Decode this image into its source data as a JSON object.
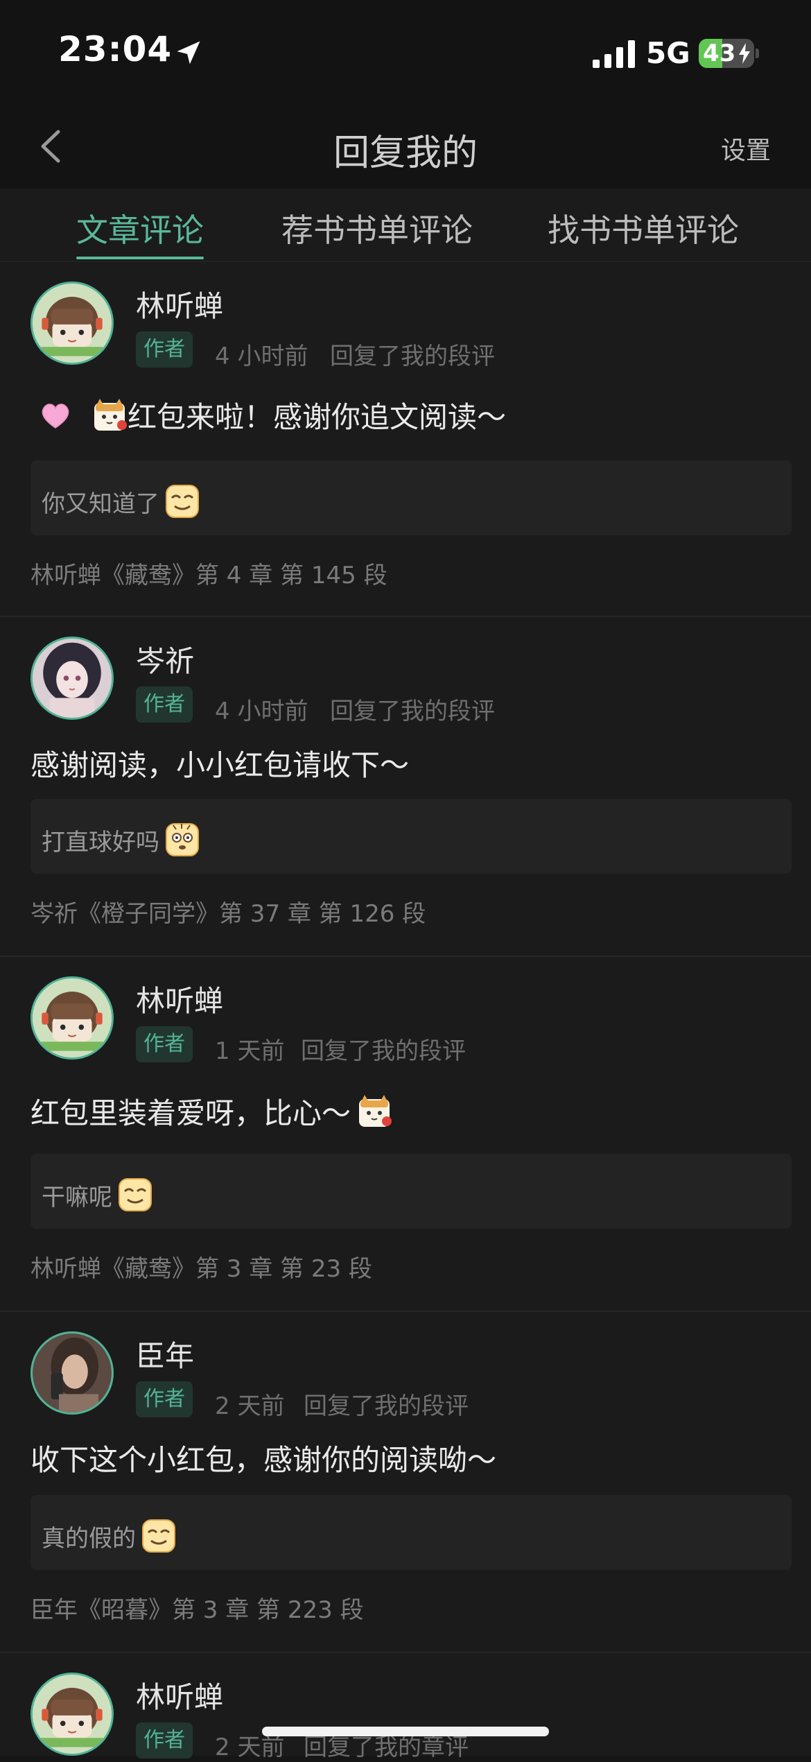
{
  "status_bar": {
    "time": "23:04",
    "network": "5G",
    "battery_level": "43",
    "battery_fraction": 0.43
  },
  "nav": {
    "title": "回复我的",
    "settings_label": "设置"
  },
  "tabs": [
    {
      "label": "文章评论",
      "active": true
    },
    {
      "label": "荐书书单评论",
      "active": false
    },
    {
      "label": "找书书单评论",
      "active": false
    }
  ],
  "items": [
    {
      "user": "林听蝉",
      "badge": "作者",
      "time": "4 小时前",
      "action": "回复了我的段评",
      "reply_emojis": [
        "heart-emoji",
        "cat-emoji"
      ],
      "reply": "红包来啦！感谢你追文阅读～",
      "quote": "你又知道了",
      "quote_emoji": "smug-face-emoji",
      "source": "林听蝉《藏鸯》第 4 章 第 145 段",
      "avatar": "chibi-girl-avatar"
    },
    {
      "user": "岑祈",
      "badge": "作者",
      "time": "4 小时前",
      "action": "回复了我的段评",
      "reply_emojis": [],
      "reply": "感谢阅读，小小红包请收下～",
      "quote": "打直球好吗",
      "quote_emoji": "startled-face-emoji",
      "source": "岑祈《橙子同学》第 37 章 第 126 段",
      "avatar": "anime-girl-avatar"
    },
    {
      "user": "林听蝉",
      "badge": "作者",
      "time": "1 天前",
      "action": "回复了我的段评",
      "reply_emojis": [
        "cat-emoji"
      ],
      "reply": "红包里装着爱呀，比心～",
      "quote": "干嘛呢",
      "quote_emoji": "smug-face-emoji",
      "source": "林听蝉《藏鸯》第 3 章 第 23 段",
      "avatar": "chibi-girl-avatar"
    },
    {
      "user": "臣年",
      "badge": "作者",
      "time": "2 天前",
      "action": "回复了我的段评",
      "reply_emojis": [],
      "reply": "收下这个小红包，感谢你的阅读呦～",
      "quote": "真的假的",
      "quote_emoji": "smug-face-emoji",
      "source": "臣年《昭暮》第 3 章 第 223 段",
      "avatar": "photo-girl-avatar"
    },
    {
      "user": "林听蝉",
      "badge": "作者",
      "time": "2 天前",
      "action": "回复了我的章评",
      "avatar": "chibi-girl-avatar"
    }
  ],
  "colors": {
    "accent": "#5ab89a",
    "background": "#161616",
    "card": "#1b1b1b",
    "quote_bg": "#232323"
  }
}
